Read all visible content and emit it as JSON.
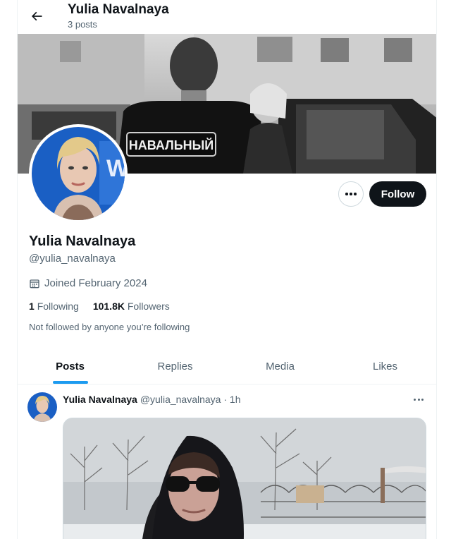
{
  "header": {
    "title": "Yulia Navalnaya",
    "post_count": "3 posts",
    "back_icon": "arrow-left-icon"
  },
  "banner": {
    "jacket_text": "НАВАЛЬНЫЙ"
  },
  "actions": {
    "more_icon": "more-horizontal-icon",
    "follow_label": "Follow"
  },
  "profile": {
    "name": "Yulia Navalnaya",
    "handle": "@yulia_navalnaya",
    "joined": "Joined February 2024",
    "following_count": "1",
    "following_label": "Following",
    "followers_count": "101.8K",
    "followers_label": "Followers",
    "not_followed": "Not followed by anyone you’re following"
  },
  "tabs": [
    {
      "label": "Posts",
      "active": true
    },
    {
      "label": "Replies",
      "active": false
    },
    {
      "label": "Media",
      "active": false
    },
    {
      "label": "Likes",
      "active": false
    }
  ],
  "post": {
    "name": "Yulia Navalnaya",
    "handle_time": "@yulia_navalnaya · 1h"
  },
  "colors": {
    "accent": "#1d9bf0",
    "text": "#0f1419",
    "secondary": "#536471"
  }
}
